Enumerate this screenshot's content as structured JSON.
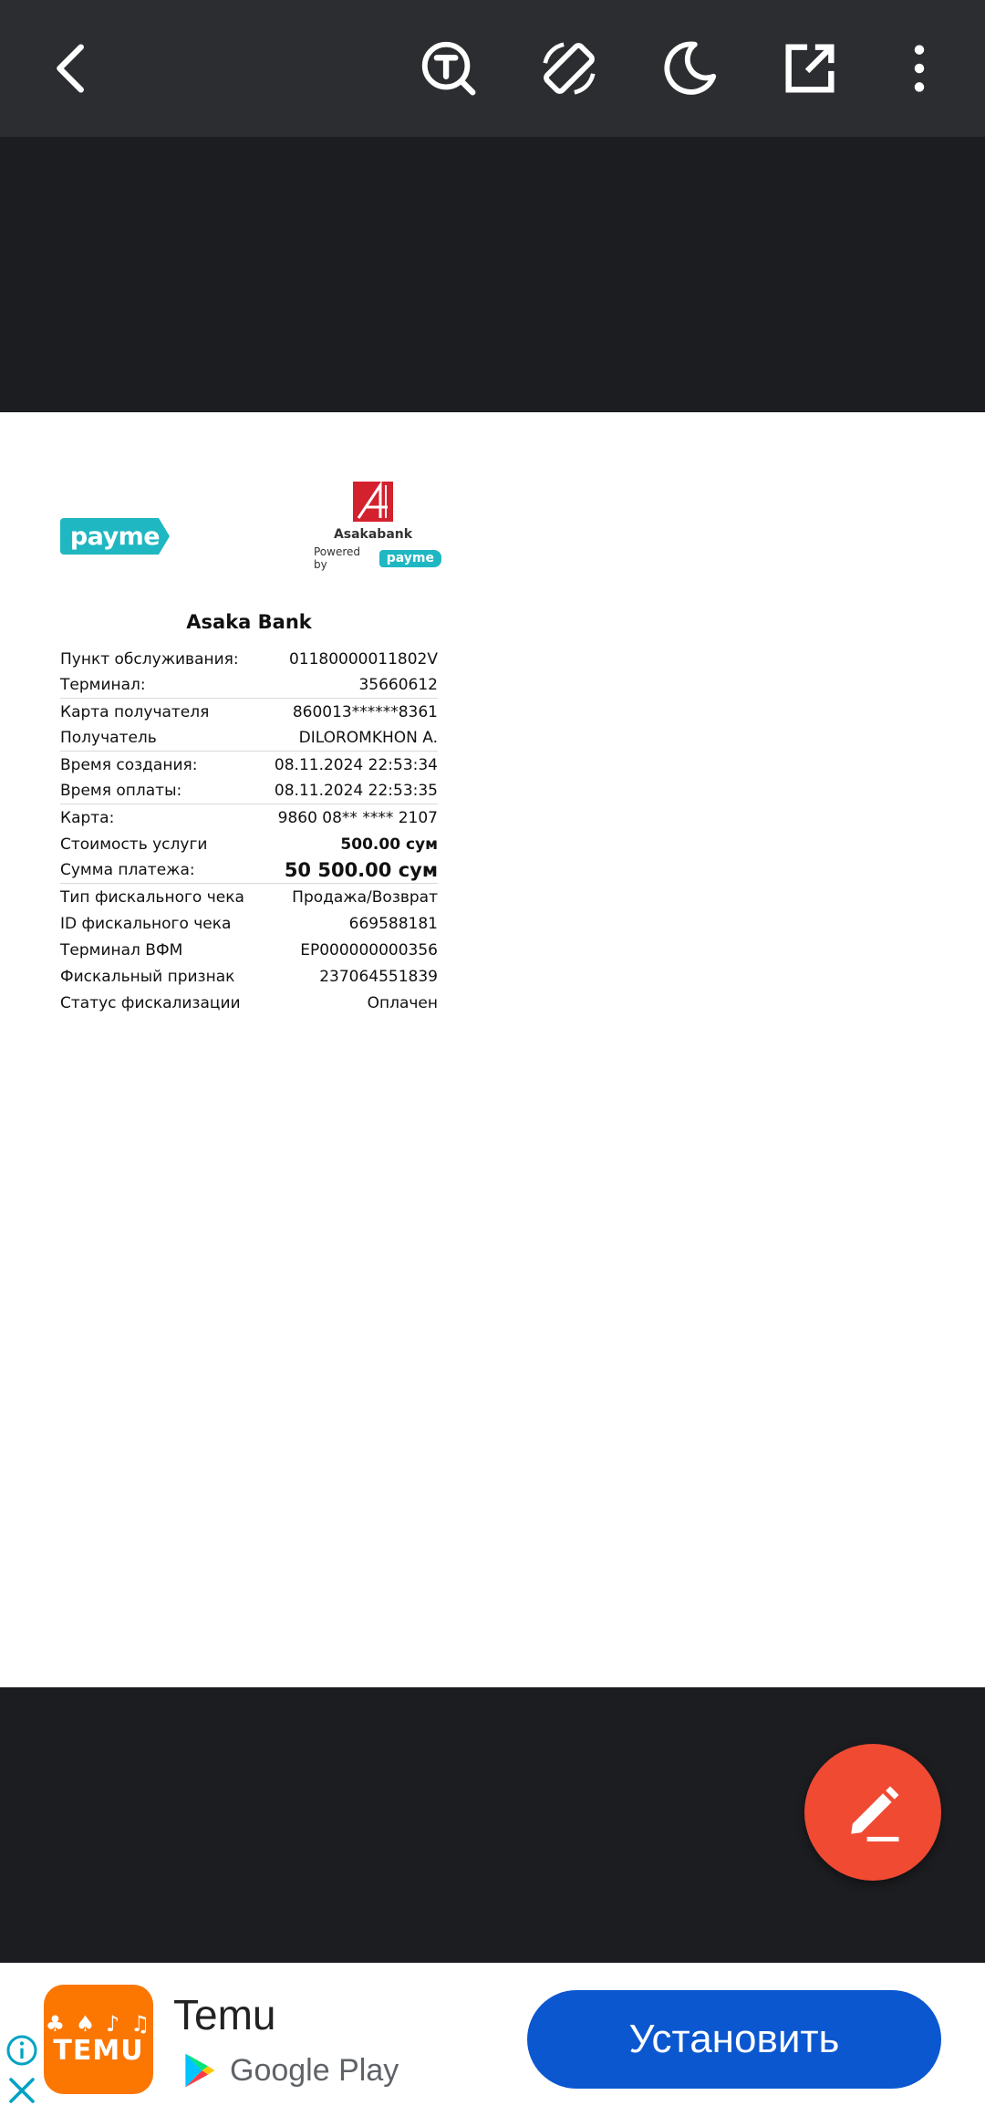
{
  "toolbar": {
    "icons": [
      "back-icon",
      "text-search-icon",
      "rotate-screen-icon",
      "night-mode-icon",
      "open-external-icon",
      "more-vert-icon"
    ]
  },
  "receipt": {
    "bank_logo_name": "Asakabank",
    "powered_by": "Powered by",
    "payme_label": "payme",
    "title": "Asaka Bank",
    "rows": [
      {
        "label": "Пункт обслуживания:",
        "value": "01180000011802V",
        "style": "normal",
        "sep": false
      },
      {
        "label": "Терминал:",
        "value": "35660612",
        "style": "normal",
        "sep": true
      },
      {
        "label": "Карта получателя",
        "value": "860013******8361",
        "style": "normal",
        "sep": false
      },
      {
        "label": "Получатель",
        "value": "DILOROMKHON A.",
        "style": "normal",
        "sep": true
      },
      {
        "label": "Время создания:",
        "value": "08.11.2024 22:53:34",
        "style": "normal",
        "sep": false
      },
      {
        "label": "Время оплаты:",
        "value": "08.11.2024 22:53:35",
        "style": "normal",
        "sep": true
      },
      {
        "label": "Карта:",
        "value": "9860 08** **** 2107",
        "style": "normal",
        "sep": false
      },
      {
        "label": "Стоимость услуги",
        "value": "500.00 сум",
        "style": "bold",
        "sep": false
      },
      {
        "label": "Сумма платежа:",
        "value": "50 500.00 сум",
        "style": "big",
        "sep": true
      },
      {
        "label": "Тип фискального чека",
        "value": "Продажа/Возврат",
        "style": "normal",
        "sep": false
      },
      {
        "label": "ID фискального чека",
        "value": "669588181",
        "style": "normal",
        "sep": false
      },
      {
        "label": "Терминал ВФМ",
        "value": "EP000000000356",
        "style": "normal",
        "sep": false
      },
      {
        "label": "Фискальный признак",
        "value": "237064551839",
        "style": "normal",
        "sep": false
      },
      {
        "label": "Статус фискализации",
        "value": "Оплачен",
        "style": "normal",
        "sep": false
      }
    ]
  },
  "fab": {
    "icon": "edit-pencil-icon",
    "color": "#f04a33"
  },
  "ad": {
    "app_name": "Temu",
    "icon_text": "TEMU",
    "store_label": "Google Play",
    "install_label": "Установить",
    "accent_color": "#0b57d0",
    "icon_color": "#fb7701"
  }
}
